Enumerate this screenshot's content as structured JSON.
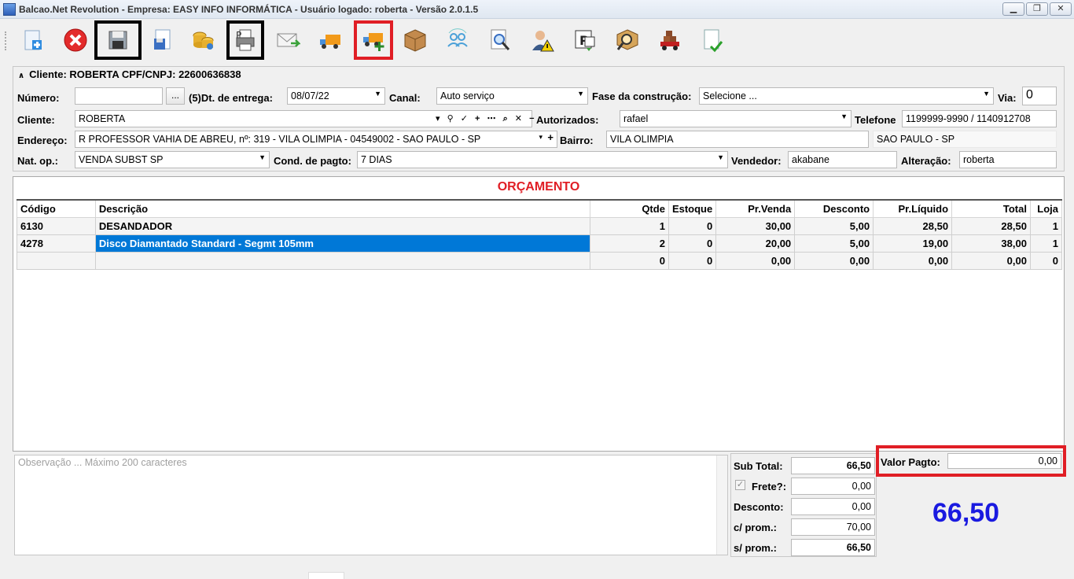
{
  "window": {
    "title": "Balcao.Net Revolution - Empresa: EASY INFO INFORMÁTICA - Usuário logado: roberta - Versão 2.0.1.5",
    "controls": {
      "minimize": "▁",
      "maximize": "❐",
      "close": "✕"
    }
  },
  "toolbar": {
    "buttons": [
      {
        "icon": "new-document-icon"
      },
      {
        "icon": "cancel-icon"
      },
      {
        "icon": "save-icon",
        "highlight": "black"
      },
      {
        "icon": "save-as-icon"
      },
      {
        "icon": "coins-icon"
      },
      {
        "icon": "print-icon",
        "highlight": "black"
      },
      {
        "icon": "email-icon"
      },
      {
        "icon": "delivery-truck-icon"
      },
      {
        "icon": "add-delivery-icon",
        "highlight": "red"
      },
      {
        "icon": "box-icon"
      },
      {
        "icon": "users-sync-icon"
      },
      {
        "icon": "search-document-icon"
      },
      {
        "icon": "user-warning-icon"
      },
      {
        "icon": "report-icon"
      },
      {
        "icon": "box-search-icon"
      },
      {
        "icon": "cargo-truck-icon"
      },
      {
        "icon": "document-check-icon"
      }
    ]
  },
  "header": {
    "client_summary": "Cliente: ROBERTA CPF/CNPJ: 22600636838",
    "numero_label": "Número:",
    "numero_value": "",
    "numero_button": "...",
    "dt_entrega_label": "(5)Dt. de entrega:",
    "dt_entrega_value": "08/07/22",
    "canal_label": "Canal:",
    "canal_value": "Auto serviço",
    "fase_label": "Fase da construção:",
    "fase_value": "Selecione ...",
    "via_label": "Via:",
    "via_value": "0",
    "cliente_label": "Cliente:",
    "cliente_value": "ROBERTA",
    "autorizados_label": "Autorizados:",
    "autorizados_value": "rafael",
    "telefone_label": "Telefone",
    "telefone_value": "1199999-9990 / 1140912708",
    "endereco_label": "Endereço:",
    "endereco_value": "R PROFESSOR VAHIA DE ABREU, nº: 319 - VILA OLIMPIA - 04549002 - SAO PAULO - SP",
    "bairro_label": "Bairro:",
    "bairro_value": "VILA OLIMPIA",
    "cidade_value": "SAO PAULO - SP",
    "natop_label": "Nat. op.:",
    "natop_value": "VENDA SUBST SP",
    "cond_label": "Cond. de pagto:",
    "cond_value": "7 DIAS",
    "vendedor_label": "Vendedor:",
    "vendedor_value": "akabane",
    "alteracao_label": "Alteração:",
    "alteracao_value": "roberta"
  },
  "grid": {
    "title": "ORÇAMENTO",
    "columns": [
      "Código",
      "Descrição",
      "Qtde",
      "Estoque",
      "Pr.Venda",
      "Desconto",
      "Pr.Líquido",
      "Total",
      "Loja"
    ],
    "rows": [
      [
        "6130",
        "DESANDADOR",
        "1",
        "0",
        "30,00",
        "5,00",
        "28,50",
        "28,50",
        "1"
      ],
      [
        "4278",
        "Disco Diamantado Standard - Segmt 105mm",
        "2",
        "0",
        "20,00",
        "5,00",
        "19,00",
        "38,00",
        "1"
      ],
      [
        "",
        "",
        "0",
        "0",
        "0,00",
        "0,00",
        "0,00",
        "0,00",
        "0"
      ]
    ]
  },
  "footer": {
    "obs_placeholder": "Observação ... Máximo 200 caracteres",
    "subtotal_label": "Sub Total:",
    "subtotal_value": "66,50",
    "frete_label": "Frete?:",
    "frete_value": "0,00",
    "desconto_label": "Desconto:",
    "desconto_value": "0,00",
    "cprom_label": "c/ prom.:",
    "cprom_value": "70,00",
    "sprom_label": "s/ prom.:",
    "sprom_value": "66,50",
    "valor_pagto_label": "Valor Pagto:",
    "valor_pagto_value": "0,00",
    "grand_total": "66,50"
  },
  "colors": {
    "accent_red": "#e01e25",
    "total_blue": "#1a1ae0",
    "selection": "#0078d7"
  }
}
